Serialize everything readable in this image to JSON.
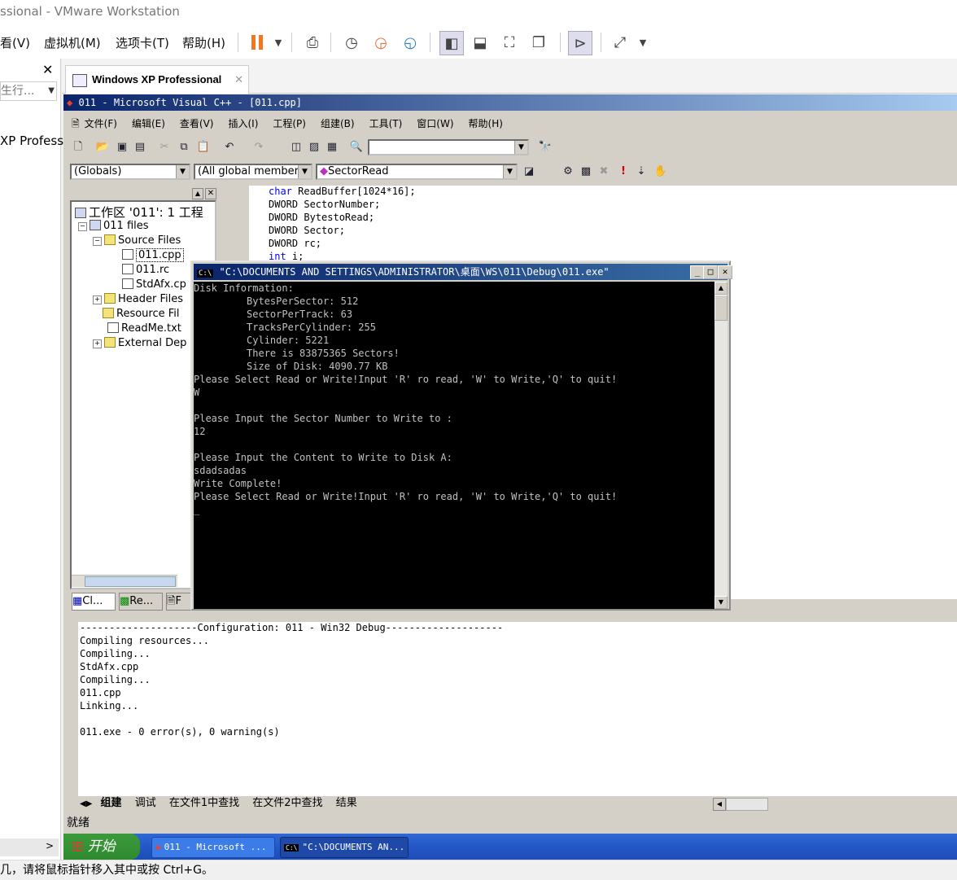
{
  "host": {
    "title": "ssional - VMware Workstation",
    "menu": [
      "看(V)",
      "虚拟机(M)",
      "选项卡(T)",
      "帮助(H)"
    ],
    "left_search_placeholder": "生行...",
    "left_item": "XP Professi",
    "tab_label": "Windows XP Professional",
    "status": "几，请将鼠标指针移入其中或按 Ctrl+G。"
  },
  "vc": {
    "title": "011 - Microsoft Visual C++ - [011.cpp]",
    "menu": [
      "文件(F)",
      "编辑(E)",
      "查看(V)",
      "插入(I)",
      "工程(P)",
      "组建(B)",
      "工具(T)",
      "窗口(W)",
      "帮助(H)"
    ],
    "combos": {
      "globals": "(Globals)",
      "members": "(All global members",
      "function": "SectorRead"
    },
    "status": "就绪"
  },
  "workspace": {
    "root": "工作区 '011': 1 工程",
    "project": "011 files",
    "source_folder": "Source Files",
    "source_files": [
      "011.cpp",
      "011.rc",
      "StdAfx.cp"
    ],
    "folders": [
      "Header Files",
      "Resource Fil"
    ],
    "readme": "ReadMe.txt",
    "external": "External Dep",
    "tabs": [
      "Cl...",
      "Re...",
      "F"
    ]
  },
  "editor": {
    "lines": [
      {
        "kw": "char",
        "rest": " ReadBuffer[1024*16];"
      },
      {
        "kw": "",
        "rest": "DWORD SectorNumber;"
      },
      {
        "kw": "",
        "rest": "DWORD BytestoRead;"
      },
      {
        "kw": "",
        "rest": "DWORD Sector;"
      },
      {
        "kw": "",
        "rest": "DWORD rc;"
      },
      {
        "kw": "int",
        "rest": " i;"
      }
    ]
  },
  "console": {
    "title": "\"C:\\DOCUMENTS AND SETTINGS\\ADMINISTRATOR\\桌面\\WS\\011\\Debug\\011.exe\"",
    "lines": [
      "Disk Information:",
      "         BytesPerSector: 512",
      "         SectorPerTrack: 63",
      "         TracksPerCylinder: 255",
      "         Cylinder: 5221",
      "         There is 83875365 Sectors!",
      "         Size of Disk: 4090.77 KB",
      "Please Select Read or Write!Input 'R' ro read, 'W' to Write,'Q' to quit!",
      "W",
      "",
      "Please Input the Sector Number to Write to :",
      "12",
      "",
      "Please Input the Content to Write to Disk A:",
      "sdadsadas",
      "Write Complete!",
      "Please Select Read or Write!Input 'R' ro read, 'W' to Write,'Q' to quit!",
      "_"
    ]
  },
  "output": {
    "lines": [
      "--------------------Configuration: 011 - Win32 Debug--------------------",
      "Compiling resources...",
      "Compiling...",
      "StdAfx.cpp",
      "Compiling...",
      "011.cpp",
      "Linking...",
      "",
      "011.exe - 0 error(s), 0 warning(s)"
    ],
    "tabs": [
      "组建",
      "调试",
      "在文件1中查找",
      "在文件2中查找",
      "结果"
    ]
  },
  "taskbar": {
    "start": "开始",
    "tasks": [
      "011 - Microsoft ...",
      "\"C:\\DOCUMENTS AN..."
    ]
  },
  "colors": {
    "keyword": "#0000ff",
    "title_active": "#0a246a",
    "taskbar": "#2457c8",
    "start": "#3c9a3c",
    "pause": "#f07820"
  }
}
